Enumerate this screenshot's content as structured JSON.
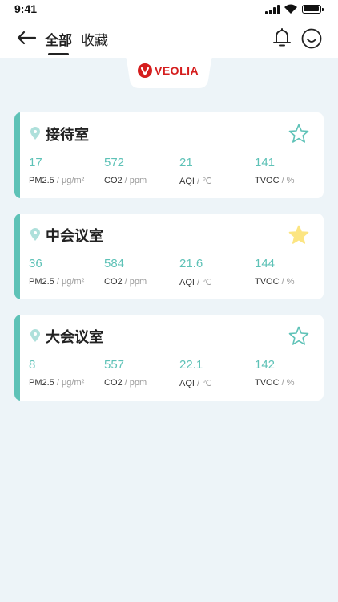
{
  "status": {
    "time": "9:41",
    "battery_level": 1.0
  },
  "header": {
    "tabs": [
      {
        "label": "全部",
        "active": true
      },
      {
        "label": "收藏",
        "active": false
      }
    ],
    "icons": [
      "back-arrow-icon",
      "bell-icon",
      "smile-face-icon"
    ]
  },
  "brand": {
    "logo_text": "VEOLIA",
    "color": "#d51d1d"
  },
  "colors": {
    "accent": "#5ec2b7",
    "star_filled": "#fce582",
    "star_outline": "#5ec2b7",
    "background": "#edf4f8"
  },
  "rooms": [
    {
      "name": "接待室",
      "favorite": false,
      "metrics": [
        {
          "value": "17",
          "label": "PM2.5",
          "unit": "μg/m²"
        },
        {
          "value": "572",
          "label": "CO2",
          "unit": "ppm"
        },
        {
          "value": "21",
          "label": "AQI",
          "unit": "℃"
        },
        {
          "value": "141",
          "label": "TVOC",
          "unit": "%"
        }
      ]
    },
    {
      "name": "中会议室",
      "favorite": true,
      "metrics": [
        {
          "value": "36",
          "label": "PM2.5",
          "unit": "μg/m²"
        },
        {
          "value": "584",
          "label": "CO2",
          "unit": "ppm"
        },
        {
          "value": "21.6",
          "label": "AQI",
          "unit": "℃"
        },
        {
          "value": "144",
          "label": "TVOC",
          "unit": "%"
        }
      ]
    },
    {
      "name": "大会议室",
      "favorite": false,
      "metrics": [
        {
          "value": "8",
          "label": "PM2.5",
          "unit": "μg/m²"
        },
        {
          "value": "557",
          "label": "CO2",
          "unit": "ppm"
        },
        {
          "value": "22.1",
          "label": "AQI",
          "unit": "℃"
        },
        {
          "value": "142",
          "label": "TVOC",
          "unit": "%"
        }
      ]
    }
  ]
}
